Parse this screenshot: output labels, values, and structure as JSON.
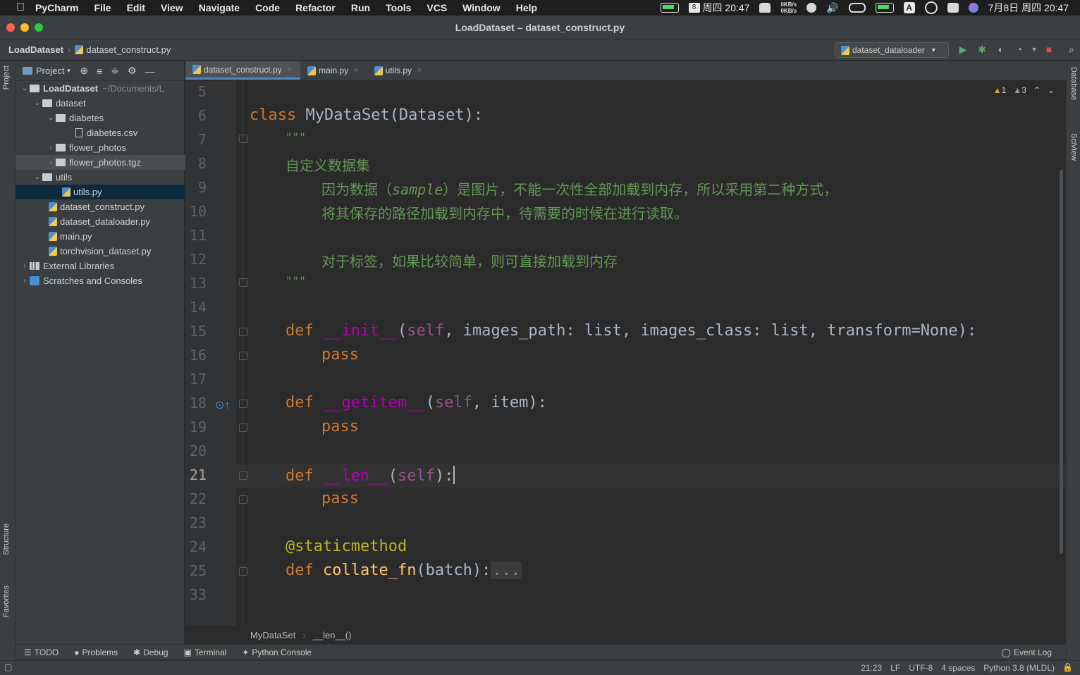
{
  "menubar": {
    "app_name": "PyCharm",
    "items": [
      "File",
      "Edit",
      "View",
      "Navigate",
      "Code",
      "Refactor",
      "Run",
      "Tools",
      "VCS",
      "Window",
      "Help"
    ],
    "calendar_day": "8",
    "clock_left": "周四 20:47",
    "net_up": "0KB/s",
    "net_down": "0KB/s",
    "input_method": "A",
    "clock_right": "7月8日 周四 20:47"
  },
  "window": {
    "title": "LoadDataset – dataset_construct.py"
  },
  "navbar": {
    "project": "LoadDataset",
    "file": "dataset_construct.py",
    "run_config": "dataset_dataloader"
  },
  "side_labels": {
    "project": "Project",
    "structure": "Structure",
    "favorites": "Favorites",
    "database": "Database",
    "sciview": "SciView"
  },
  "project_panel": {
    "header": "Project",
    "root": {
      "name": "LoadDataset",
      "path": "~/Documents/L"
    },
    "rows": [
      {
        "label": "dataset"
      },
      {
        "label": "diabetes"
      },
      {
        "label": "diabetes.csv"
      },
      {
        "label": "flower_photos"
      },
      {
        "label": "flower_photos.tgz"
      },
      {
        "label": "utils"
      },
      {
        "label": "utils.py"
      },
      {
        "label": "dataset_construct.py"
      },
      {
        "label": "dataset_dataloader.py"
      },
      {
        "label": "main.py"
      },
      {
        "label": "torchvision_dataset.py"
      },
      {
        "label": "External Libraries"
      },
      {
        "label": "Scratches and Consoles"
      }
    ]
  },
  "tabs": [
    {
      "label": "dataset_construct.py",
      "active": true
    },
    {
      "label": "main.py"
    },
    {
      "label": "utils.py"
    }
  ],
  "inspections": {
    "warnings": "1",
    "weak_warnings": "3"
  },
  "editor": {
    "line_numbers": [
      "5",
      "6",
      "7",
      "8",
      "9",
      "10",
      "11",
      "12",
      "13",
      "14",
      "15",
      "16",
      "17",
      "18",
      "19",
      "20",
      "21",
      "22",
      "23",
      "24",
      "25",
      "33"
    ],
    "current_line": "21",
    "code": {
      "class_kw": "class ",
      "class_name": "MyDataSet(Dataset):",
      "doc_open": "\"\"\"",
      "doc1": "自定义数据集",
      "doc2a": "因为数据（",
      "doc2b": "sample",
      "doc2c": "）是图片，不能一次性全部加载到内存，所以采用第二种方式，",
      "doc3": "将其保存的路径加载到内存中，待需要的时候在进行读取。",
      "doc4": "对于标签，如果比较简单，则可直接加载到内存",
      "doc_close": "\"\"\"",
      "def": "def ",
      "init_name": "__init__",
      "init_open": "(",
      "self": "self",
      "init_args": ", images_path: list, images_class: list, transform=None):",
      "pass": "pass",
      "getitem_name": "__getitem__",
      "getitem_args": ", item):",
      "len_name": "__len__",
      "len_args": "):",
      "decorator": "@staticmethod",
      "collate": "collate_fn",
      "collate_args": "(batch):",
      "folded": "..."
    }
  },
  "breadcrumb": {
    "class": "MyDataSet",
    "method": "__len__()"
  },
  "bottom_tools": [
    "TODO",
    "Problems",
    "Debug",
    "Terminal",
    "Python Console"
  ],
  "event_log": "Event Log",
  "status": {
    "position": "21:23",
    "line_sep": "LF",
    "encoding": "UTF-8",
    "indent": "4 spaces",
    "interpreter": "Python 3.8 (MLDL)"
  }
}
